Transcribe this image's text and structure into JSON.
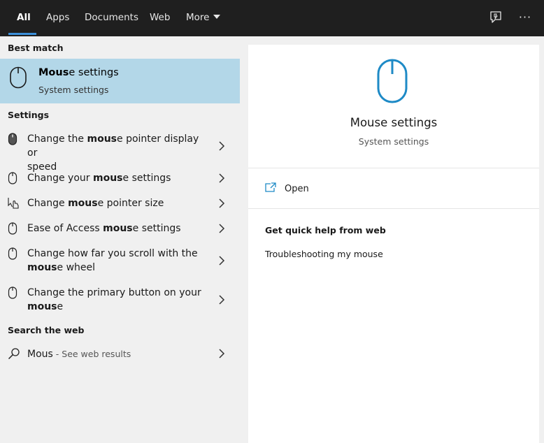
{
  "tabs": [
    {
      "label": "All",
      "active": true
    },
    {
      "label": "Apps"
    },
    {
      "label": "Documents"
    },
    {
      "label": "Web"
    },
    {
      "label": "More"
    }
  ],
  "topbar_icons": {
    "feedback": "feedback-icon",
    "options": "more-options-icon",
    "options_glyph": "···"
  },
  "best_match": {
    "header": "Best match",
    "title_bold": "Mous",
    "title_rest": "e settings",
    "subtitle": "System settings",
    "icon": "mouse-icon"
  },
  "settings": {
    "header": "Settings",
    "items": [
      {
        "icon": "mouse-filled-icon",
        "line1_pre": "Change the ",
        "line1_bold": "mous",
        "line1_post": "e pointer display or",
        "line2": "speed"
      },
      {
        "icon": "mouse-icon",
        "pre": "Change your ",
        "bold": "mous",
        "post": "e settings"
      },
      {
        "icon": "pointer-hand-icon",
        "pre": "Change ",
        "bold": "mous",
        "post": "e pointer size"
      },
      {
        "icon": "mouse-icon",
        "pre": "Ease of Access ",
        "bold": "mous",
        "post": "e settings"
      },
      {
        "icon": "mouse-icon",
        "line1": "Change how far you scroll with the",
        "line2_bold": "mous",
        "line2_post": "e wheel"
      },
      {
        "icon": "mouse-icon",
        "line1": "Change the primary button on your",
        "line2_bold": "mous",
        "line2_post": "e"
      }
    ]
  },
  "web": {
    "header": "Search the web",
    "query": "Mous",
    "suffix": " - See web results",
    "icon": "search-icon"
  },
  "preview": {
    "title": "Mouse settings",
    "subtitle": "System settings",
    "icon": "mouse-icon",
    "open_label": "Open",
    "help_header": "Get quick help from web",
    "help_link": "Troubleshooting my mouse"
  },
  "colors": {
    "topbar": "#1f1f1f",
    "accent": "#3b8fd9",
    "selected_row": "#b3d7e8",
    "icon_blue": "#1e8ac6"
  }
}
